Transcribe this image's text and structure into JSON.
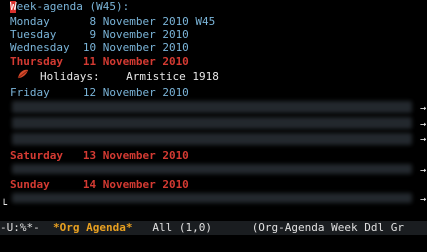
{
  "agenda": {
    "header": "Week-agenda (W45):",
    "header_first_letter": "W",
    "header_rest": "eek-agenda (W45):",
    "days": [
      {
        "text": "Monday      8 November 2010 W45"
      },
      {
        "text": "Tuesday     9 November 2010"
      },
      {
        "text": "Wednesday  10 November 2010"
      },
      {
        "text": "Thursday   11 November 2010"
      },
      {
        "text": "Friday     12 November 2010"
      },
      {
        "text": "Saturday   13 November 2010"
      },
      {
        "text": "Sunday     14 November 2010"
      }
    ],
    "holiday_label": "Holidays:",
    "holiday_event": "Armistice 1918"
  },
  "modeline": {
    "left": "-U:%*-  ",
    "buffer_name": "*Org Agenda*",
    "position": "   All (1,0)      ",
    "mode": "(Org-Agenda Week Ddl Gr"
  },
  "colors": {
    "background": "#000000",
    "day_text": "#7ab4d8",
    "weekend": "#d43a32",
    "cursor": "#d9302c",
    "modeline_bg": "#1a1d20",
    "buffer_name": "#e8a020"
  }
}
